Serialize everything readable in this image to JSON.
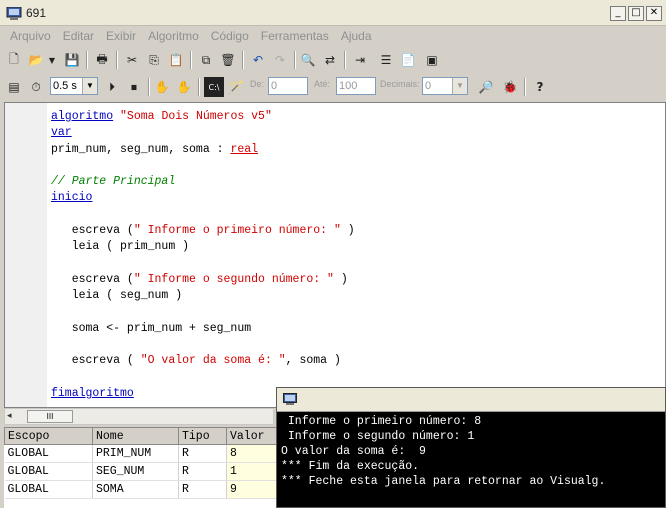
{
  "window": {
    "title": "691"
  },
  "menu": [
    "Arquivo",
    "Editar",
    "Exibir",
    "Algoritmo",
    "Código",
    "Ferramentas",
    "Ajuda"
  ],
  "toolbar2": {
    "speed": "0.5 s",
    "de_label": "De:",
    "de_value": "0",
    "ate_label": "Até:",
    "ate_value": "100",
    "decimais_label": "Decimais:",
    "decimais_value": "0"
  },
  "code": {
    "l1_kw": "algoritmo",
    "l1_str": "\"Soma Dois Números v5\"",
    "l2_kw": "var",
    "l3_text": "prim_num, seg_num, soma : ",
    "l3_type": "real",
    "l5_cmt": "// Parte Principal",
    "l6_kw": "inicio",
    "l8_a": "   escreva (",
    "l8_str": "\" Informe o primeiro número: \"",
    "l8_b": " )",
    "l9": "   leia ( prim_num )",
    "l11_a": "   escreva (",
    "l11_str": "\" Informe o segundo número: \"",
    "l11_b": " )",
    "l12": "   leia ( seg_num )",
    "l14": "   soma <- prim_num + seg_num",
    "l16_a": "   escreva ( ",
    "l16_str": "\"O valor da soma é: \"",
    "l16_b": ", soma )",
    "l18_kw": "fimalgoritmo"
  },
  "variables": {
    "headers": [
      "Escopo",
      "Nome",
      "Tipo",
      "Valor"
    ],
    "rows": [
      [
        "GLOBAL",
        "PRIM_NUM",
        "R",
        "8"
      ],
      [
        "GLOBAL",
        "SEG_NUM",
        "R",
        "1"
      ],
      [
        "GLOBAL",
        "SOMA",
        "R",
        "9"
      ]
    ]
  },
  "console": {
    "lines": [
      " Informe o primeiro número: 8",
      " Informe o segundo número: 1",
      "O valor da soma é:  9",
      "*** Fim da execução.",
      "*** Feche esta janela para retornar ao Visualg."
    ]
  },
  "hscroll_thumb": "III",
  "colors": {
    "keyword": "#0000c0",
    "string": "#d00000",
    "comment": "#008000",
    "console_bg": "#000000"
  }
}
